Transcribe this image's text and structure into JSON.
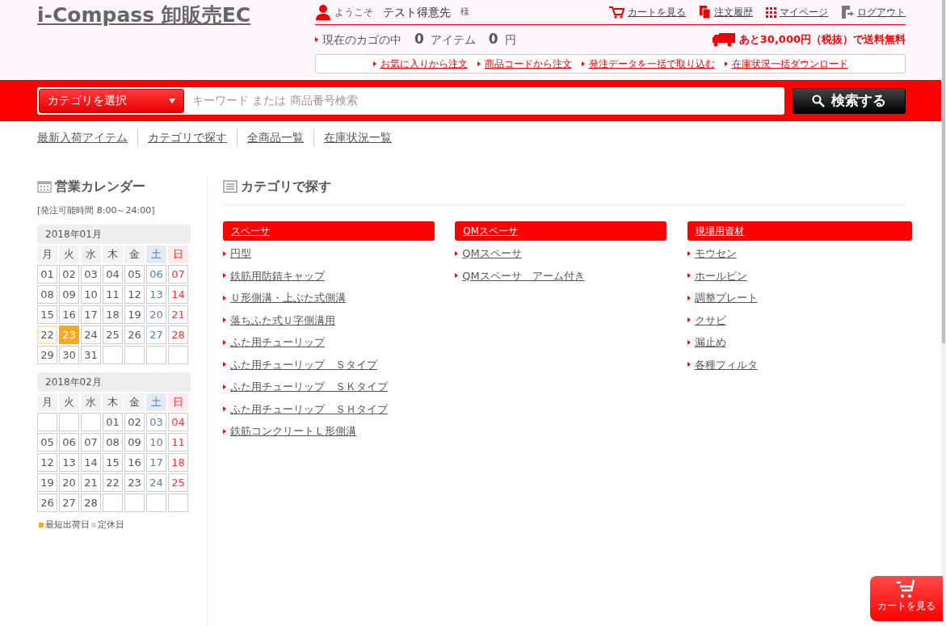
{
  "logo": "i-Compass 卸販売EC",
  "welcome": {
    "prefix": "ようこそ",
    "customer": "テスト得意先",
    "suffix": "様"
  },
  "user_links": [
    {
      "kind": "cart",
      "label": "カートを見る"
    },
    {
      "kind": "history",
      "label": "注文履歴"
    },
    {
      "kind": "mypage",
      "label": "マイページ"
    },
    {
      "kind": "logout",
      "label": "ログアウト"
    }
  ],
  "basket": {
    "label": "現在のカゴの中",
    "items": "0",
    "items_unit": "アイテム",
    "amount": "0",
    "amount_unit": "円"
  },
  "shipping_note": "あと30,000円（税抜）で送料無料",
  "quick_links": [
    "お気に入りから注文",
    "商品コードから注文",
    "発注データを一括で取り込む",
    "在庫状況一括ダウンロード"
  ],
  "search": {
    "category": "カテゴリを選択",
    "placeholder": "キーワード または 商品番号検索",
    "button": "検索する"
  },
  "nav": [
    "最新入荷アイテム",
    "カテゴリで探す",
    "全商品一覧",
    "在庫状況一覧"
  ],
  "sidebar": {
    "title": "営業カレンダー",
    "hours": "[発注可能時間 8:00～24:00]",
    "months": [
      {
        "title": "2018年01月",
        "weekdays": [
          {
            "label": "月",
            "kind": "weekday"
          },
          {
            "label": "火",
            "kind": "weekday"
          },
          {
            "label": "水",
            "kind": "weekday"
          },
          {
            "label": "木",
            "kind": "weekday"
          },
          {
            "label": "金",
            "kind": "weekday"
          },
          {
            "label": "土",
            "kind": "saturday"
          },
          {
            "label": "日",
            "kind": "sunday"
          }
        ],
        "days": [
          {
            "day": "01",
            "kind": "weekday"
          },
          {
            "day": "02",
            "kind": "weekday"
          },
          {
            "day": "03",
            "kind": "weekday"
          },
          {
            "day": "04",
            "kind": "weekday"
          },
          {
            "day": "05",
            "kind": "weekday"
          },
          {
            "day": "06",
            "kind": "saturday"
          },
          {
            "day": "07",
            "kind": "sunday"
          },
          {
            "day": "08",
            "kind": "weekday"
          },
          {
            "day": "09",
            "kind": "weekday"
          },
          {
            "day": "10",
            "kind": "weekday"
          },
          {
            "day": "11",
            "kind": "weekday"
          },
          {
            "day": "12",
            "kind": "weekday"
          },
          {
            "day": "13",
            "kind": "saturday"
          },
          {
            "day": "14",
            "kind": "sunday"
          },
          {
            "day": "15",
            "kind": "weekday"
          },
          {
            "day": "16",
            "kind": "weekday"
          },
          {
            "day": "17",
            "kind": "weekday"
          },
          {
            "day": "18",
            "kind": "weekday"
          },
          {
            "day": "19",
            "kind": "weekday"
          },
          {
            "day": "20",
            "kind": "saturday"
          },
          {
            "day": "21",
            "kind": "sunday"
          },
          {
            "day": "22",
            "kind": "today"
          },
          {
            "day": "23",
            "kind": "shortest"
          },
          {
            "day": "24",
            "kind": "weekday"
          },
          {
            "day": "25",
            "kind": "weekday"
          },
          {
            "day": "26",
            "kind": "weekday"
          },
          {
            "day": "27",
            "kind": "saturday"
          },
          {
            "day": "28",
            "kind": "sunday"
          },
          {
            "day": "29",
            "kind": "weekday"
          },
          {
            "day": "30",
            "kind": "weekday"
          },
          {
            "day": "31",
            "kind": "weekday"
          },
          {
            "kind": "blank"
          },
          {
            "kind": "blank"
          },
          {
            "kind": "blank"
          },
          {
            "kind": "blank"
          }
        ]
      },
      {
        "title": "2018年02月",
        "weekdays": [
          {
            "label": "月",
            "kind": "weekday"
          },
          {
            "label": "火",
            "kind": "weekday"
          },
          {
            "label": "水",
            "kind": "weekday"
          },
          {
            "label": "木",
            "kind": "weekday"
          },
          {
            "label": "金",
            "kind": "weekday"
          },
          {
            "label": "土",
            "kind": "saturday"
          },
          {
            "label": "日",
            "kind": "sunday"
          }
        ],
        "days": [
          {
            "kind": "blank"
          },
          {
            "kind": "blank"
          },
          {
            "kind": "blank"
          },
          {
            "day": "01",
            "kind": "weekday"
          },
          {
            "day": "02",
            "kind": "weekday"
          },
          {
            "day": "03",
            "kind": "saturday"
          },
          {
            "day": "04",
            "kind": "sunday"
          },
          {
            "day": "05",
            "kind": "weekday"
          },
          {
            "day": "06",
            "kind": "weekday"
          },
          {
            "day": "07",
            "kind": "weekday"
          },
          {
            "day": "08",
            "kind": "weekday"
          },
          {
            "day": "09",
            "kind": "weekday"
          },
          {
            "day": "10",
            "kind": "saturday"
          },
          {
            "day": "11",
            "kind": "sunday"
          },
          {
            "day": "12",
            "kind": "weekday"
          },
          {
            "day": "13",
            "kind": "weekday"
          },
          {
            "day": "14",
            "kind": "weekday"
          },
          {
            "day": "15",
            "kind": "weekday"
          },
          {
            "day": "16",
            "kind": "weekday"
          },
          {
            "day": "17",
            "kind": "saturday"
          },
          {
            "day": "18",
            "kind": "sunday"
          },
          {
            "day": "19",
            "kind": "weekday"
          },
          {
            "day": "20",
            "kind": "weekday"
          },
          {
            "day": "21",
            "kind": "weekday"
          },
          {
            "day": "22",
            "kind": "weekday"
          },
          {
            "day": "23",
            "kind": "weekday"
          },
          {
            "day": "24",
            "kind": "saturday"
          },
          {
            "day": "25",
            "kind": "sunday"
          },
          {
            "day": "26",
            "kind": "weekday"
          },
          {
            "day": "27",
            "kind": "weekday"
          },
          {
            "day": "28",
            "kind": "weekday"
          },
          {
            "kind": "blank"
          },
          {
            "kind": "blank"
          },
          {
            "kind": "blank"
          },
          {
            "kind": "blank"
          }
        ]
      }
    ],
    "legend": [
      {
        "label": "最短出荷日",
        "color": "#f9a91c"
      },
      {
        "label": "定休日",
        "color": "#d9d9d9"
      }
    ]
  },
  "main": {
    "title": "カテゴリで探す",
    "categories": [
      {
        "name": "スペーサ",
        "items": [
          "円型",
          "鉄筋用防錆キャップ",
          "Ｕ形側溝・上ぶた式側溝",
          "落ちふた式Ｕ字側溝用",
          "ふた用チューリップ",
          "ふた用チューリップ　Ｓタイプ",
          "ふた用チューリップ　ＳＫタイプ",
          "ふた用チューリップ　ＳＨタイプ",
          "鉄筋コンクリートＬ形側溝"
        ]
      },
      {
        "name": "QMスペーサ",
        "items": [
          "QMスペーサ",
          "QMスペーサ　アーム付き"
        ]
      },
      {
        "name": "現場用資材",
        "items": [
          "モウセン",
          "ホールピン",
          "調整プレート",
          "クサビ",
          "漏止め",
          "各種フィルタ"
        ]
      }
    ]
  },
  "floating_cart": "カートを見る"
}
